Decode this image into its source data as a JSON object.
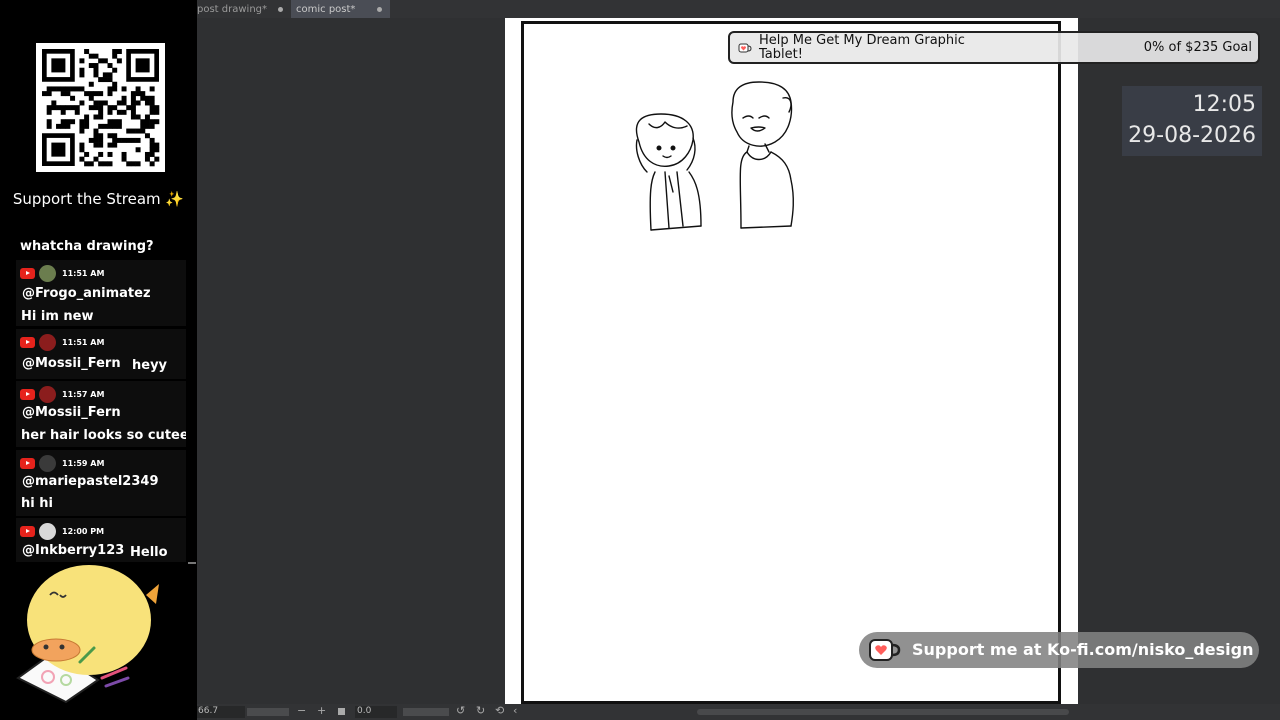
{
  "sidebar": {
    "support_title": "Support the Stream ✨",
    "chat": {
      "first_message": "whatcha drawing?",
      "messages": [
        {
          "time": "11:51 AM",
          "user": "@Frogo_animatez",
          "text": "Hi im new",
          "avatar_color": "#6b7d4e"
        },
        {
          "time": "11:51 AM",
          "user": "@Mossii_Fern",
          "text": "heyy",
          "avatar_color": "#8b1d1d"
        },
        {
          "time": "11:57 AM",
          "user": "@Mossii_Fern",
          "text": "her hair looks so cutee",
          "avatar_color": "#8b1d1d"
        },
        {
          "time": "11:59 AM",
          "user": "@mariepastel2349",
          "text": "hi hi",
          "avatar_color": "#3a3a3a"
        },
        {
          "time": "12:00 PM",
          "user": "@Inkberry123",
          "text": "Hello",
          "avatar_color": "#d8d8d8"
        }
      ]
    }
  },
  "tabs": [
    {
      "label": "post drawing*"
    },
    {
      "label": "comic post*"
    }
  ],
  "goal": {
    "title": "Help Me Get My Dream Graphic Tablet!",
    "progress": "0% of $235 Goal"
  },
  "clock": {
    "time": "12:05",
    "date": "29-08-2026"
  },
  "kofi": {
    "text": "Support me at Ko-fi.com/nisko_design"
  },
  "statusbar": {
    "zoom": "66.7",
    "rotation": "0.0"
  },
  "colors": {
    "youtube_red": "#e6231c",
    "kofi_red": "#ff5e5b",
    "background": "#2f3032"
  }
}
